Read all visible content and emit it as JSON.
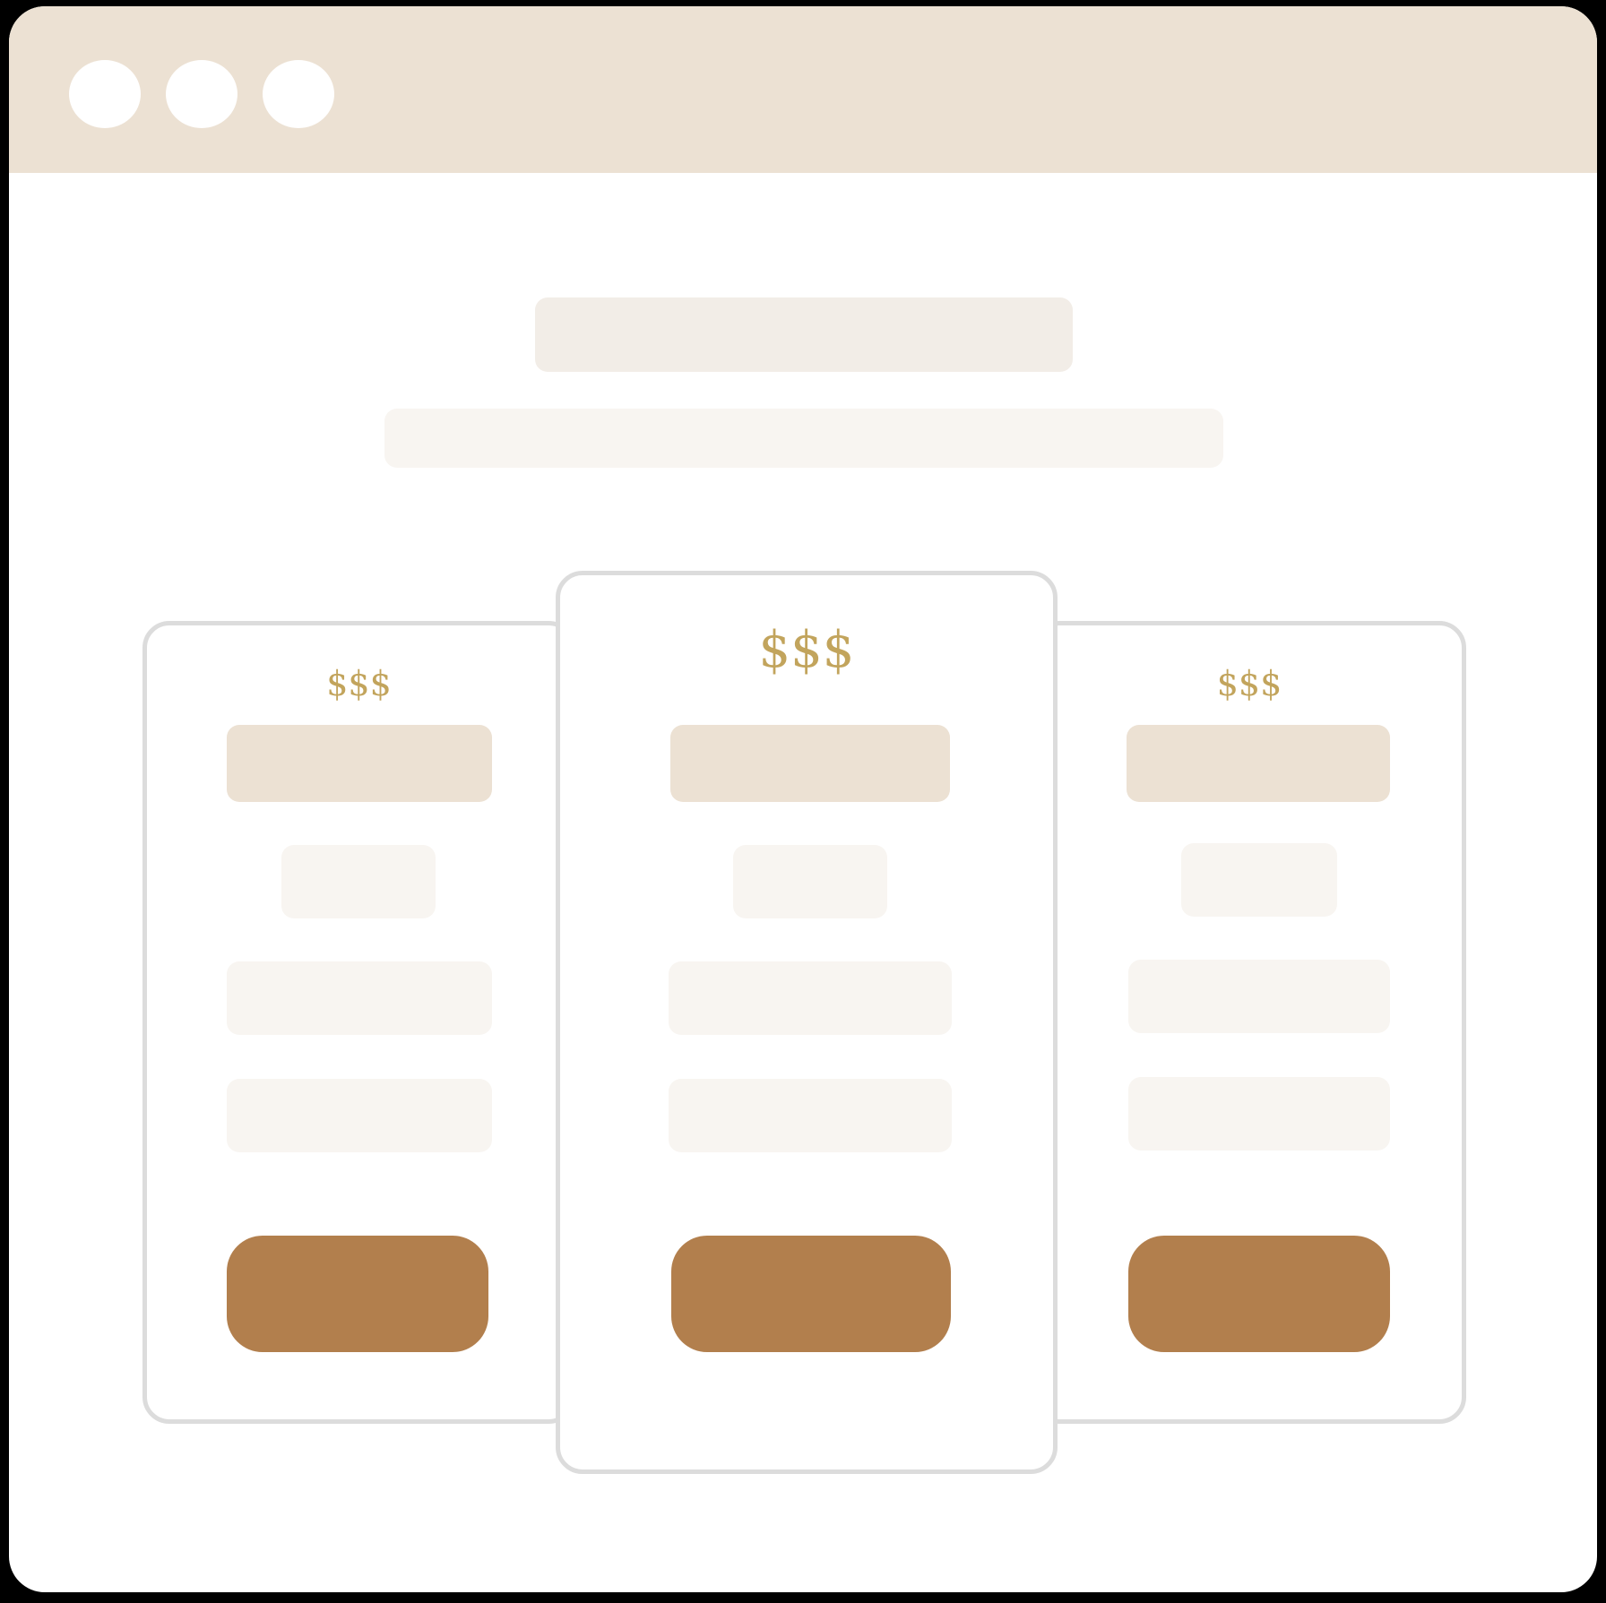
{
  "window": {
    "traffic_lights": [
      "close",
      "minimize",
      "maximize"
    ]
  },
  "colors": {
    "titlebar": "#ece1d3",
    "price_text": "#c2a45c",
    "cta_button": "#b27f4d",
    "card_border": "#dcdcdc",
    "placeholder_light": "#f8f5f1"
  },
  "pricing": {
    "cards": [
      {
        "position": "left",
        "price": "$$$"
      },
      {
        "position": "center",
        "price": "$$$",
        "featured": true
      },
      {
        "position": "right",
        "price": "$$$"
      }
    ]
  }
}
